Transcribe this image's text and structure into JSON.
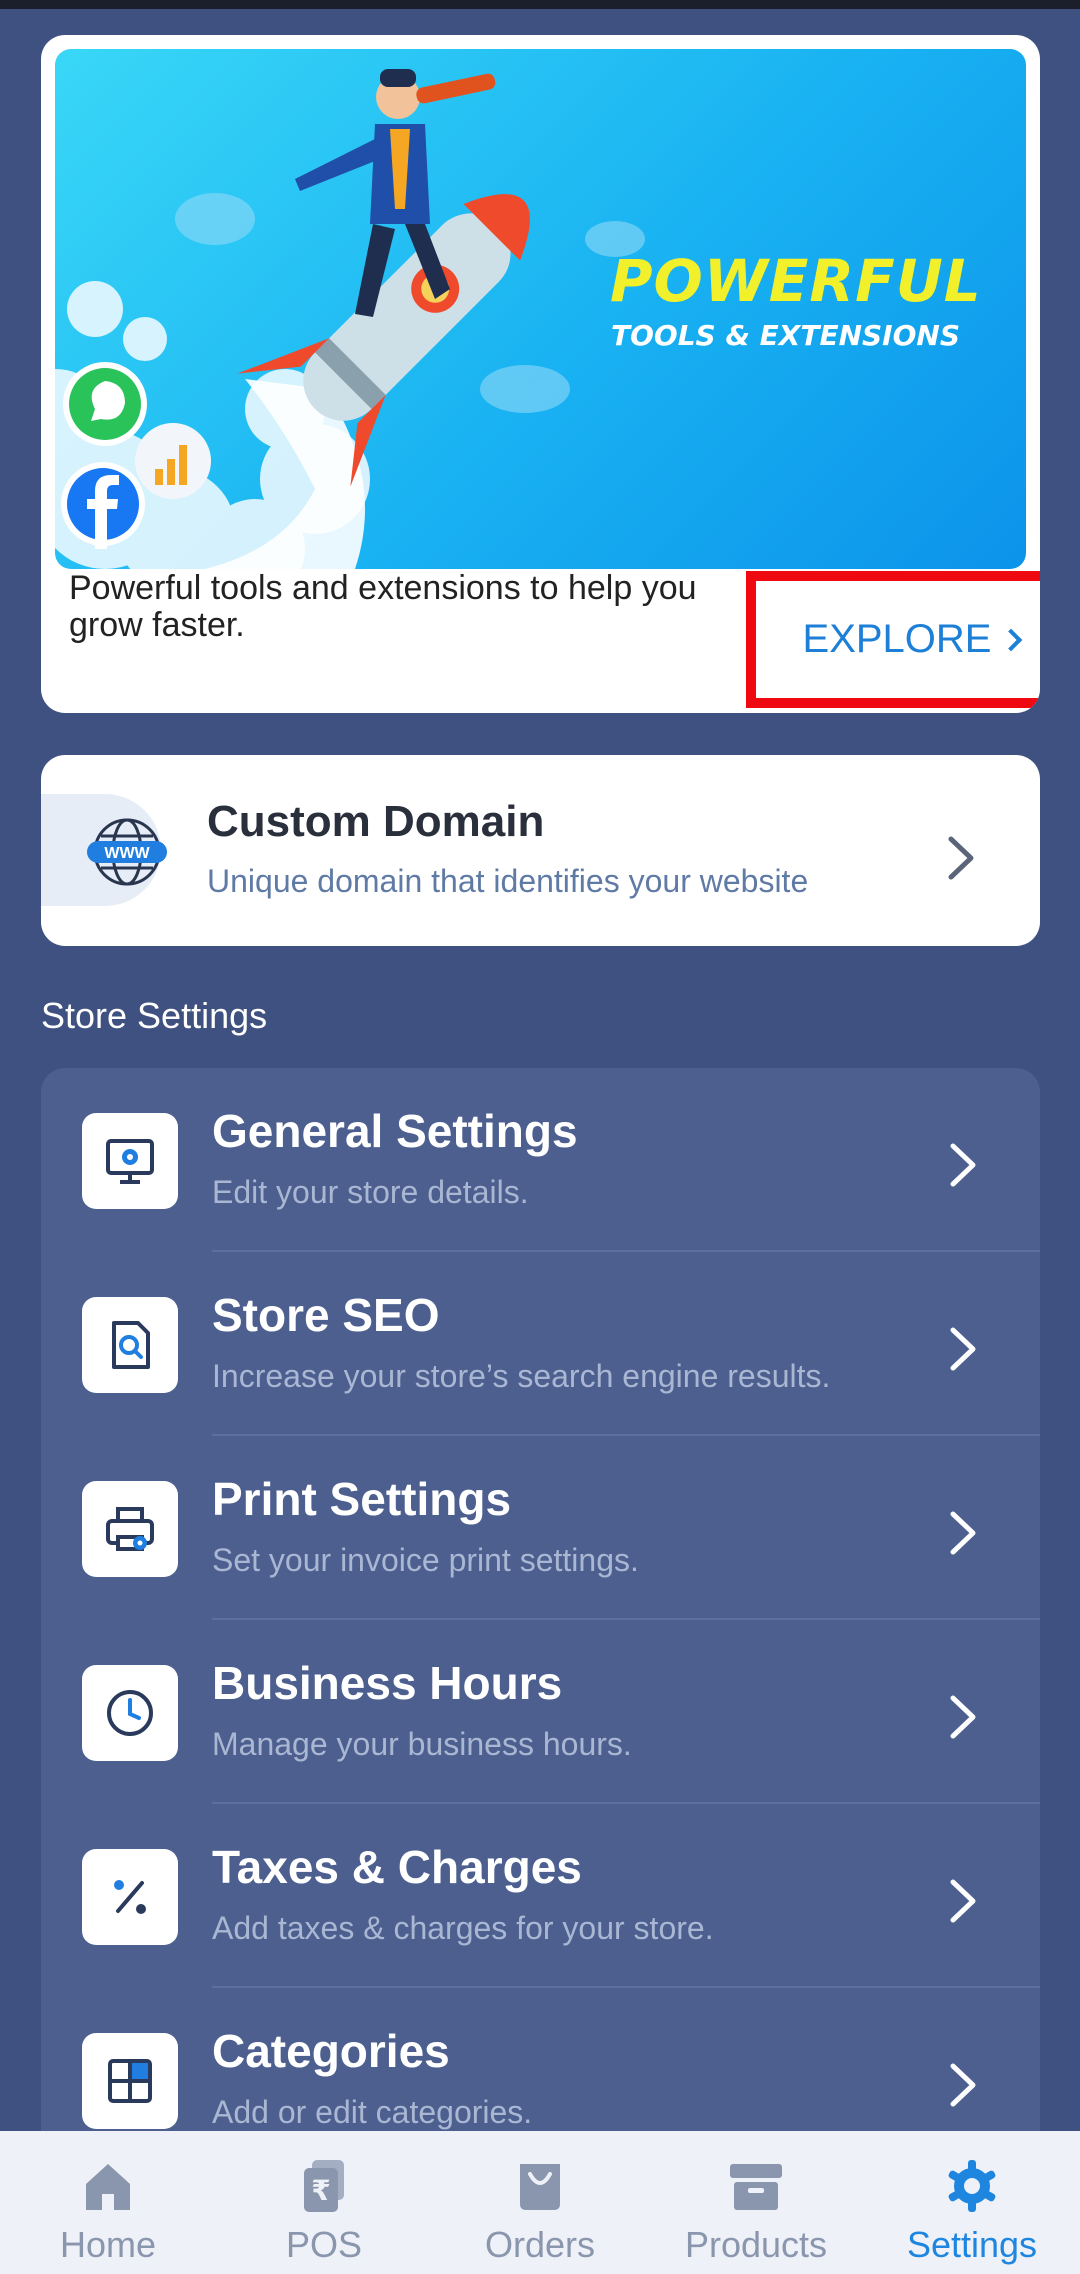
{
  "promo": {
    "title": "POWERFUL",
    "subtitle": "TOOLS & EXTENSIONS",
    "text": "Powerful tools and extensions to help you grow faster.",
    "explore_label": "EXPLORE"
  },
  "domain": {
    "title": "Custom Domain",
    "subtitle": "Unique domain that identifies your website",
    "icon_text": "WWW"
  },
  "store_settings": {
    "section_title": "Store Settings",
    "items": [
      {
        "title": "General Settings",
        "subtitle": "Edit your store details.",
        "icon": "monitor-gear-icon"
      },
      {
        "title": "Store SEO",
        "subtitle": "Increase your store’s search engine results.",
        "icon": "document-search-icon"
      },
      {
        "title": "Print Settings",
        "subtitle": "Set your invoice print settings.",
        "icon": "printer-gear-icon"
      },
      {
        "title": "Business Hours",
        "subtitle": "Manage your business hours.",
        "icon": "clock-icon"
      },
      {
        "title": "Taxes & Charges",
        "subtitle": "Add taxes & charges for your store.",
        "icon": "percent-icon"
      },
      {
        "title": "Categories",
        "subtitle": "Add or edit categories.",
        "icon": "grid-icon"
      }
    ]
  },
  "nav": {
    "items": [
      {
        "label": "Home",
        "icon": "home-icon"
      },
      {
        "label": "POS",
        "icon": "pos-rupee-icon"
      },
      {
        "label": "Orders",
        "icon": "shopping-bag-icon"
      },
      {
        "label": "Products",
        "icon": "archive-box-icon"
      },
      {
        "label": "Settings",
        "icon": "gear-icon"
      }
    ],
    "active": "Settings",
    "active_color": "#1f86e0",
    "inactive_color": "#8a96ad"
  }
}
